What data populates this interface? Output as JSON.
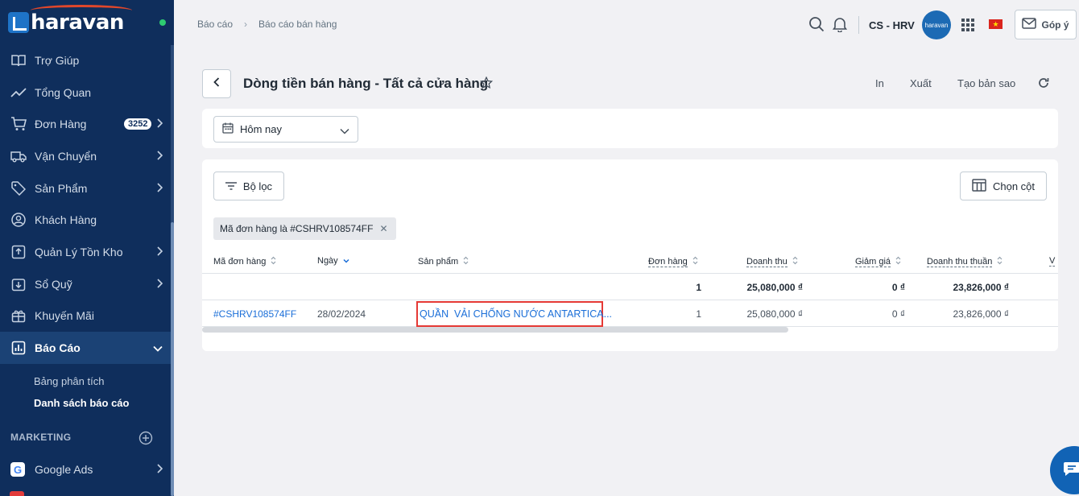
{
  "brand": {
    "name": "haravan"
  },
  "sidebar": {
    "items": [
      {
        "label": "Trợ Giúp",
        "icon": "book-icon"
      },
      {
        "label": "Tổng Quan",
        "icon": "trend-icon"
      },
      {
        "label": "Đơn Hàng",
        "icon": "cart-icon",
        "badge": "3252"
      },
      {
        "label": "Vận Chuyển",
        "icon": "truck-icon"
      },
      {
        "label": "Sản Phẩm",
        "icon": "tag-icon"
      },
      {
        "label": "Khách Hàng",
        "icon": "user-icon"
      },
      {
        "label": "Quản Lý Tồn Kho",
        "icon": "inventory-icon"
      },
      {
        "label": "Sổ Quỹ",
        "icon": "cashbook-icon"
      },
      {
        "label": "Khuyến Mãi",
        "icon": "gift-icon"
      },
      {
        "label": "Báo Cáo",
        "icon": "report-icon",
        "active": true
      }
    ],
    "sub_items": [
      {
        "label": "Bảng phân tích"
      },
      {
        "label": "Danh sách báo cáo",
        "current": true
      }
    ],
    "section_title": "MARKETING",
    "google_ads": "Google Ads"
  },
  "topbar": {
    "breadcrumbs": [
      "Báo cáo",
      "Báo cáo bán hàng"
    ],
    "store": "CS - HRV",
    "avatar_text": "haravan",
    "feedback": "Góp ý"
  },
  "page": {
    "title": "Dòng tiền bán hàng - Tất cả cửa hàng",
    "actions": {
      "print": "In",
      "export": "Xuất",
      "copy": "Tạo bản sao"
    }
  },
  "date_filter": {
    "value": "Hôm nay"
  },
  "report": {
    "filter_label": "Bộ lọc",
    "columns_label": "Chọn cột",
    "chip": "Mã đơn hàng là #CSHRV108574FF",
    "headers": {
      "order_code": "Mã đơn hàng",
      "date": "Ngày",
      "product": "Sản phẩm",
      "orders": "Đơn hàng",
      "revenue": "Doanh thu",
      "discount": "Giảm giá",
      "net_revenue": "Doanh thu thuần",
      "next_col": "V"
    },
    "summary": {
      "orders": "1",
      "revenue": "25,080,000 ₫",
      "discount": "0 ₫",
      "net_revenue": "23,826,000 ₫"
    },
    "rows": [
      {
        "order_code": "#CSHRV108574FF",
        "date": "28/02/2024",
        "product": "QUẦN  VẢI CHỐNG NƯỚC ANTARTICA...",
        "orders": "1",
        "revenue": "25,080,000 ₫",
        "discount": "0 ₫",
        "net_revenue": "23,826,000 ₫"
      }
    ]
  }
}
